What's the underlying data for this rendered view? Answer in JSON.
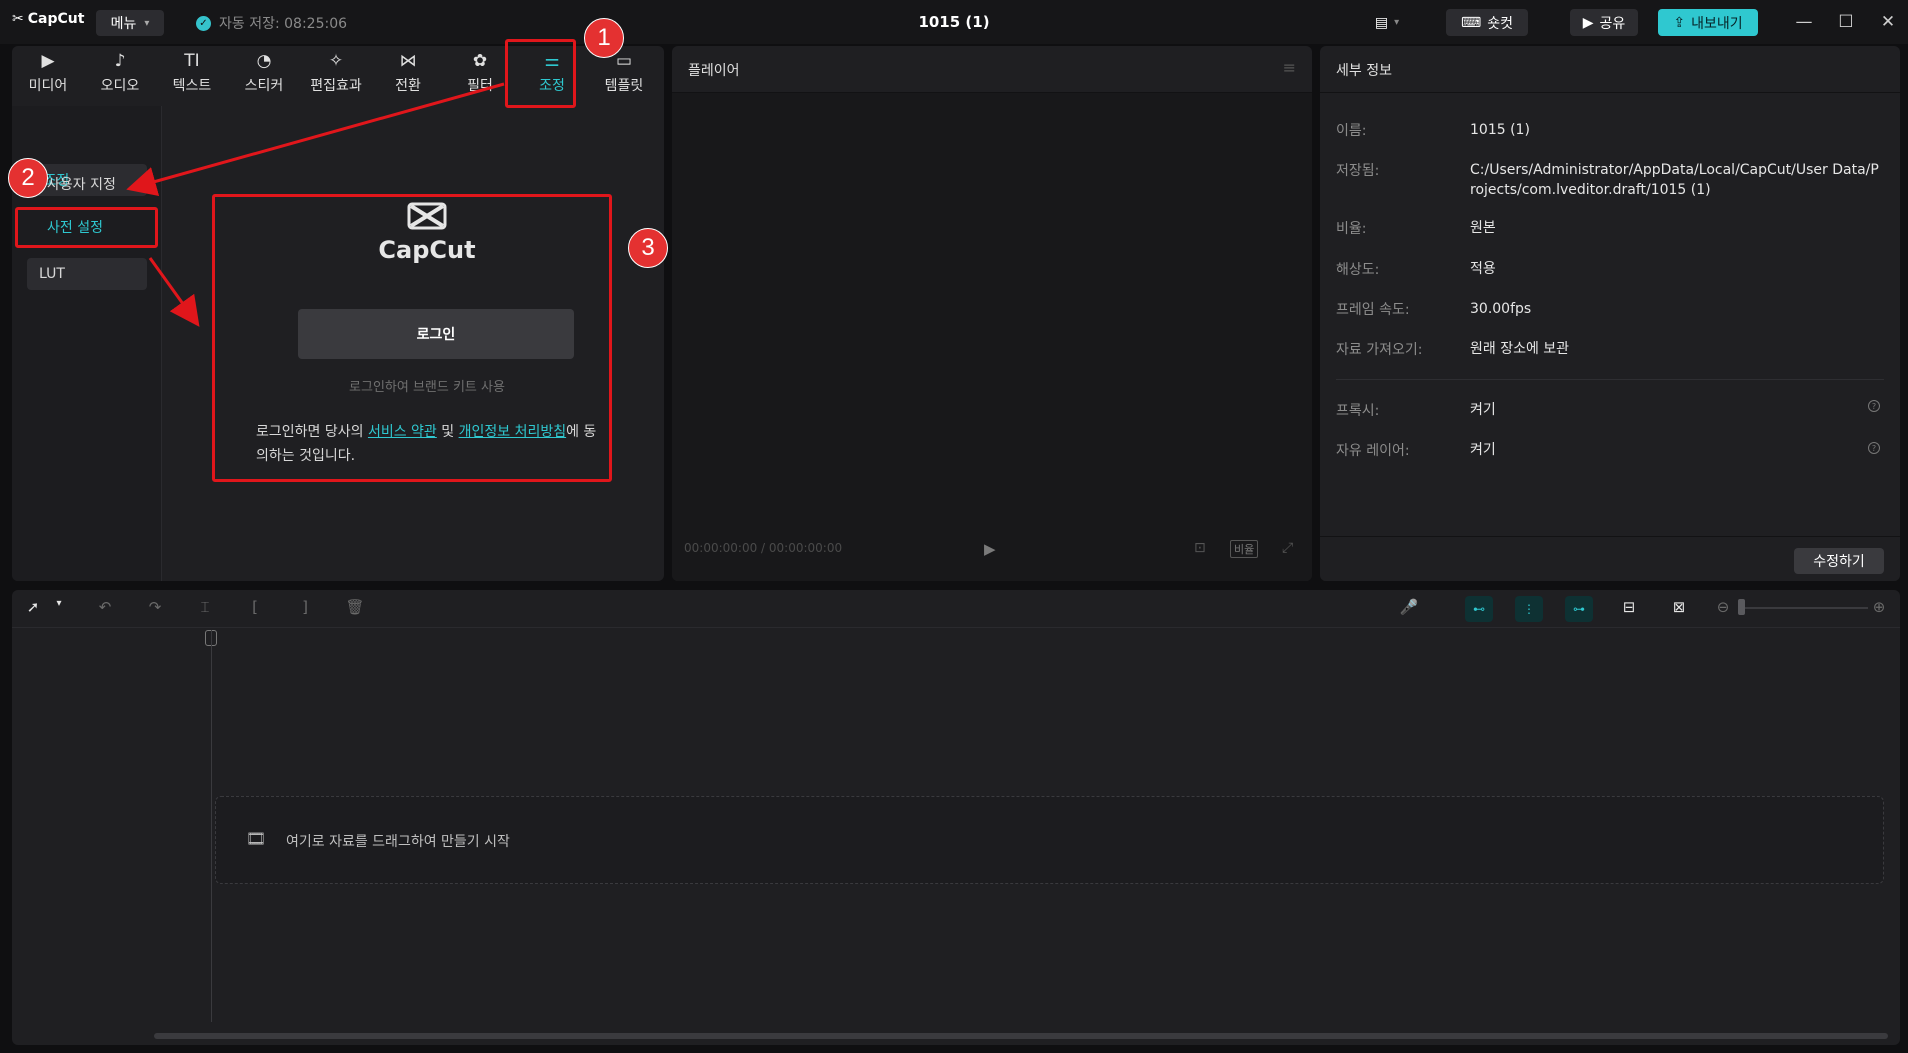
{
  "titlebar": {
    "app_name": "CapCut",
    "menu_label": "메뉴",
    "autosave": "자동 저장: 08:25:06",
    "project_title": "1015 (1)",
    "shortcut_label": "숏컷",
    "share_label": "공유",
    "export_label": "내보내기"
  },
  "tabs": [
    {
      "label": "미디어",
      "icon": "media-icon"
    },
    {
      "label": "오디오",
      "icon": "audio-icon"
    },
    {
      "label": "텍스트",
      "icon": "text-icon"
    },
    {
      "label": "스티커",
      "icon": "sticker-icon"
    },
    {
      "label": "편집효과",
      "icon": "effects-icon"
    },
    {
      "label": "전환",
      "icon": "transition-icon"
    },
    {
      "label": "필터",
      "icon": "filter-icon"
    },
    {
      "label": "조정",
      "icon": "adjust-icon"
    },
    {
      "label": "템플릿",
      "icon": "template-icon"
    }
  ],
  "sidebar": {
    "group": "조정",
    "items": [
      "사용자 지정",
      "사전 설정",
      "LUT"
    ]
  },
  "login": {
    "brand": "CapCut",
    "button": "로그인",
    "hint": "로그인하여 브랜드 키트 사용",
    "terms_prefix": "로그인하면 당사의 ",
    "terms_link1": "서비스 약관",
    "terms_mid": " 및 ",
    "terms_link2": "개인정보 처리방침",
    "terms_suffix": "에 동의하는 것입니다."
  },
  "player": {
    "title": "플레이어",
    "timecode": "00:00:00:00 / 00:00:00:00",
    "ratio_label": "비율"
  },
  "details": {
    "title": "세부 정보",
    "rows": [
      {
        "label": "이름:",
        "value": "1015 (1)"
      },
      {
        "label": "저장됨:",
        "value": "C:/Users/Administrator/AppData/Local/CapCut/User Data/Projects/com.lveditor.draft/1015 (1)"
      },
      {
        "label": "비율:",
        "value": "원본"
      },
      {
        "label": "해상도:",
        "value": "적용"
      },
      {
        "label": "프레임 속도:",
        "value": "30.00fps"
      },
      {
        "label": "자료 가져오기:",
        "value": "원래 장소에 보관"
      },
      {
        "label": "프록시:",
        "value": "켜기"
      },
      {
        "label": "자유 레이어:",
        "value": "켜기"
      }
    ],
    "edit_button": "수정하기"
  },
  "timeline": {
    "drop_hint": "여기로 자료를 드래그하여 만들기 시작"
  },
  "annotations": [
    "1",
    "2",
    "3"
  ],
  "colors": {
    "accent": "#2fc8d0",
    "annotation": "#e43131"
  }
}
